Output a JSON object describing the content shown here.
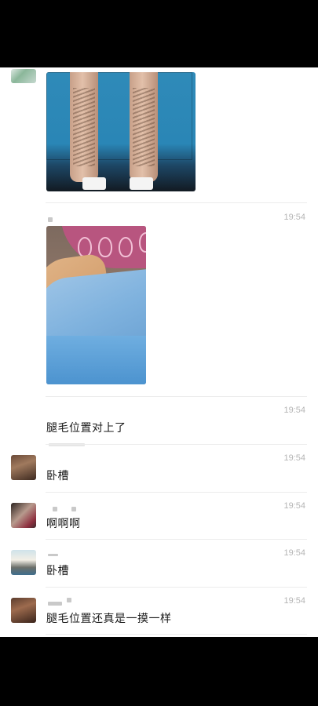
{
  "messages": [
    {
      "type": "image",
      "description_name": "legs-photo"
    },
    {
      "type": "image",
      "time": "19:54"
    },
    {
      "type": "text",
      "time": "19:54",
      "text": "腿毛位置对上了"
    },
    {
      "type": "text",
      "time": "19:54",
      "text": "卧槽"
    },
    {
      "type": "text",
      "time": "19:54",
      "text": "啊啊啊"
    },
    {
      "type": "text",
      "time": "19:54",
      "text": "卧槽"
    },
    {
      "type": "text",
      "time": "19:54",
      "text": "腿毛位置还真是一摸一样"
    }
  ]
}
